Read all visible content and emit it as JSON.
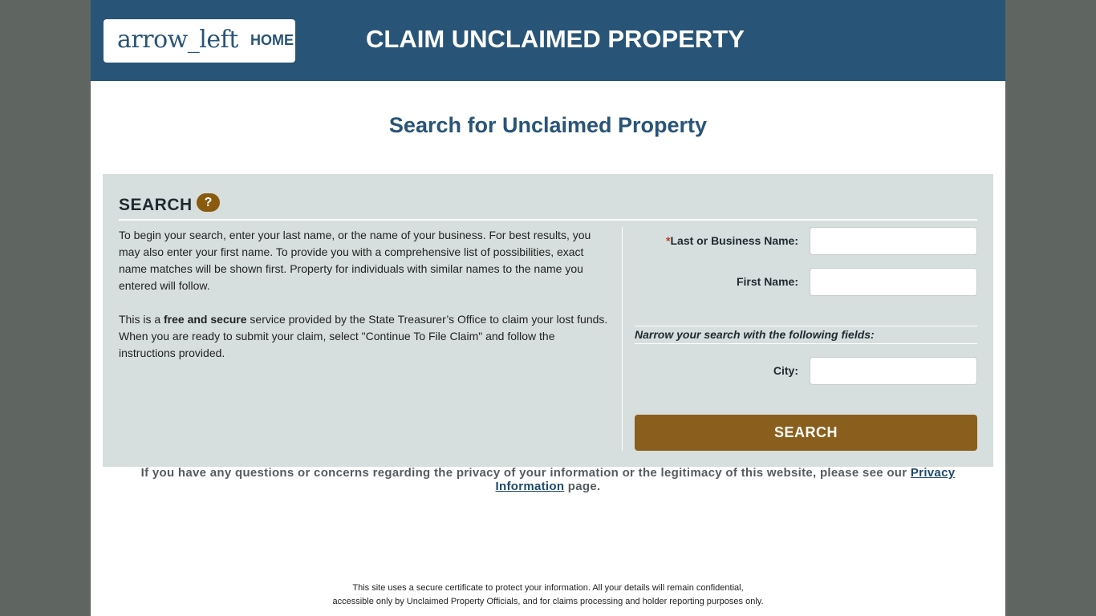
{
  "header": {
    "home_icon_text": "arrow_left",
    "home_label": "HOME",
    "site_title": "CLAIM UNCLAIMED PROPERTY"
  },
  "main": {
    "page_title": "Search for Unclaimed Property"
  },
  "search_panel": {
    "heading": "SEARCH",
    "help_icon": "?",
    "intro_p1": "To begin your search, enter your last name, or the name of your business. For best results, you may also enter your first name. To provide you with a comprehensive list of possibilities, exact name matches will be shown first. Property for individuals with similar names to the name you entered will follow.",
    "intro_p2_prefix": "This is a ",
    "intro_p2_bold": "free and secure",
    "intro_p2_suffix": " service provided by the State Treasurer’s Office to claim your lost funds. When you are ready to submit your claim, select \"Continue To File Claim\" and follow the instructions provided.",
    "required_marker": "*",
    "last_name_label": "Last or Business Name:",
    "last_name_value": "",
    "first_name_label": "First Name:",
    "first_name_value": "",
    "narrow_text": "Narrow your search with the following fields:",
    "city_label": "City:",
    "city_value": "",
    "search_button": "SEARCH"
  },
  "privacy": {
    "text": "If you have any questions or concerns regarding the privacy of your information or the legitimacy of this website, please see our ",
    "link": "Privacy Information",
    "suffix": " page."
  },
  "footer": {
    "line1": "This site uses a secure certificate to protect your information. All your details will remain confidential,",
    "line2": "accessible only by Unclaimed Property Officials, and for claims processing and holder reporting purposes only."
  },
  "colors": {
    "header_bg": "#285477",
    "panel_bg": "#d6dfdd",
    "button_bg": "#8a5e1c",
    "help_icon_bg": "#8a5a0e",
    "outer_bg": "#5f6560"
  }
}
